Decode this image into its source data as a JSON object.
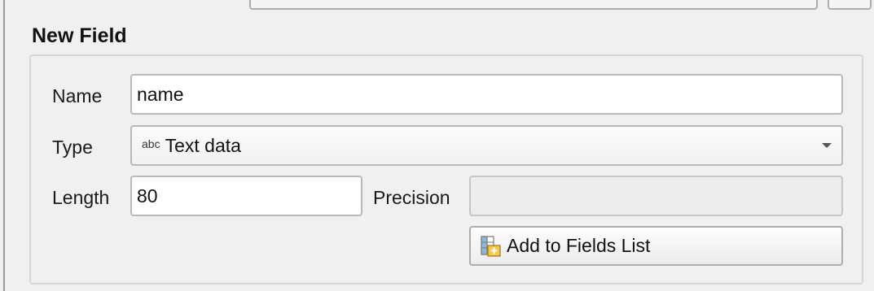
{
  "group": {
    "title": "New Field"
  },
  "name_row": {
    "label": "Name",
    "value": "name"
  },
  "type_row": {
    "label": "Type",
    "type_icon_text": "abc",
    "selected": "Text data"
  },
  "length_row": {
    "label": "Length",
    "value": "80",
    "precision_label": "Precision",
    "precision_value": ""
  },
  "add_button": {
    "label": "Add to Fields List",
    "icon": "add-field-table-icon"
  },
  "colors": {
    "background": "#f0f0f0",
    "border": "#b9b9b9",
    "field_bg": "#ffffff"
  }
}
